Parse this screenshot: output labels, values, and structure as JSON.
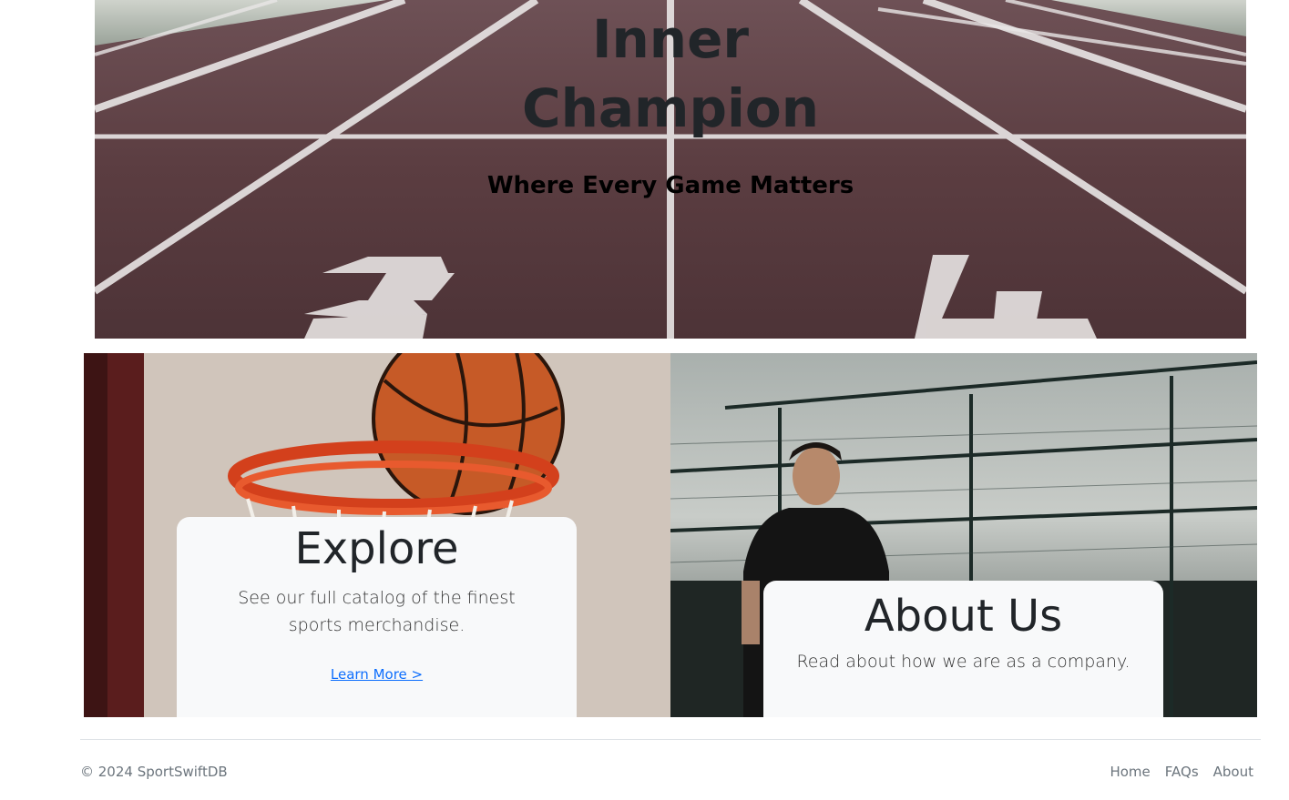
{
  "hero": {
    "title_line1": "Inner",
    "title_line2": "Champion",
    "subtitle": "Where Every Game Matters"
  },
  "cards": {
    "explore": {
      "title": "Explore",
      "text": "See our full catalog of the finest sports merchandise.",
      "link": "Learn More >"
    },
    "about": {
      "title": "About Us",
      "text": "Read about how we are as a company."
    }
  },
  "footer": {
    "copyright": "© 2024 SportSwiftDB",
    "nav": [
      "Home",
      "FAQs",
      "About"
    ]
  },
  "colors": {
    "track": "#5a3d40",
    "link": "#0d6efd",
    "card_bg": "#f8f9fa"
  },
  "icons": {
    "hero_image": "running-track-image",
    "explore_image": "basketball-hoop-image",
    "about_image": "smiling-athlete-image"
  }
}
